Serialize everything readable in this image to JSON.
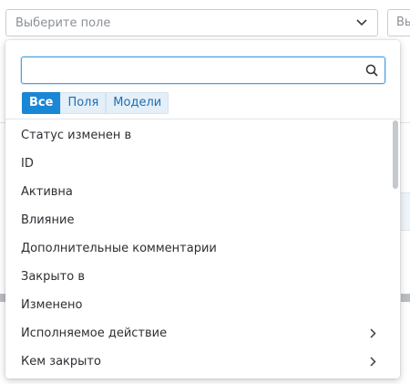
{
  "select": {
    "placeholder": "Выберите поле",
    "ghost_text": "Выб"
  },
  "search": {
    "value": "",
    "placeholder": ""
  },
  "tabs": [
    {
      "label": "Все",
      "active": true
    },
    {
      "label": "Поля",
      "active": false
    },
    {
      "label": "Модели",
      "active": false
    }
  ],
  "fields": [
    {
      "label": "Статус изменен в",
      "has_submenu": false
    },
    {
      "label": "ID",
      "has_submenu": false
    },
    {
      "label": "Активна",
      "has_submenu": false
    },
    {
      "label": "Влияние",
      "has_submenu": false
    },
    {
      "label": "Дополнительные комментарии",
      "has_submenu": false
    },
    {
      "label": "Закрыто в",
      "has_submenu": false
    },
    {
      "label": "Изменено",
      "has_submenu": false
    },
    {
      "label": "Исполняемое действие",
      "has_submenu": true
    },
    {
      "label": "Кем закрыто",
      "has_submenu": true
    }
  ],
  "colors": {
    "accent": "#1a86d6",
    "tab_inactive_bg": "#e4eff8",
    "focus_border": "#4a9fe0"
  },
  "icons": {
    "dropdown": "chevron-down-icon",
    "search": "search-icon",
    "submenu": "chevron-right-icon"
  }
}
